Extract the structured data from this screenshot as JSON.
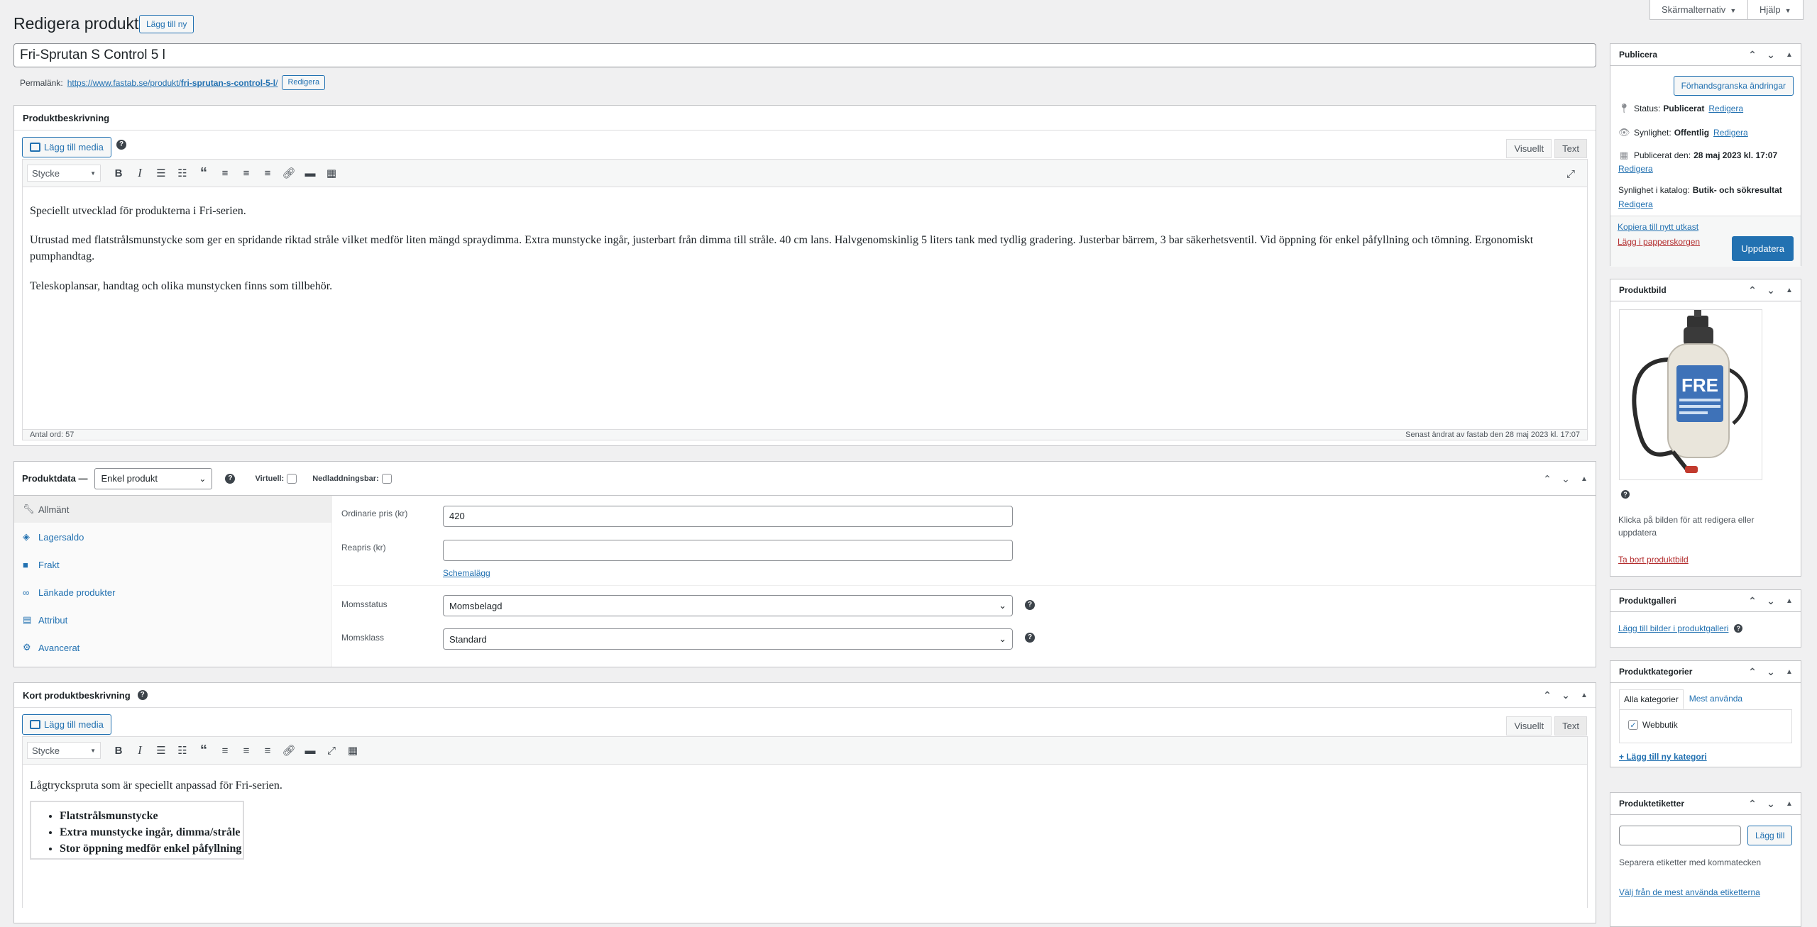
{
  "header": {
    "title": "Redigera produkt",
    "add_new": "Lägg till ny",
    "screen_options": "Skärmalternativ",
    "help": "Hjälp"
  },
  "product": {
    "title": "Fri-Sprutan S Control 5 l",
    "permalink_label": "Permalänk:",
    "permalink_base": "https://www.fastab.se/produkt/",
    "permalink_slug": "fri-sprutan-s-control-5-l",
    "permalink_end": "/",
    "permalink_edit": "Redigera"
  },
  "description_box": {
    "title": "Produktbeskrivning",
    "add_media": "Lägg till media",
    "tab_visual": "Visuellt",
    "tab_text": "Text",
    "format_select": "Stycke",
    "paragraphs": [
      "Speciellt utvecklad för produkterna i Fri-serien.",
      "Utrustad med flatstrålsmunstycke som ger en spridande riktad stråle vilket medför liten mängd spraydimma. Extra munstycke ingår, justerbart från dimma till stråle. 40 cm lans. Halvgenomskinlig 5 liters tank med tydlig gradering. Justerbar bärrem, 3 bar säkerhetsventil. Vid öppning för enkel påfyllning och tömning. Ergonomiskt pumphandtag.",
      "Teleskoplansar, handtag och olika munstycken finns som tillbehör."
    ],
    "word_count": "Antal ord: 57",
    "last_edited": "Senast ändrat av fastab den 28 maj 2023 kl. 17:07"
  },
  "product_data": {
    "title": "Produktdata —",
    "type": "Enkel produkt",
    "virtual_label": "Virtuell:",
    "downloadable_label": "Nedladdningsbar:",
    "tabs": [
      {
        "label": "Allmänt",
        "icon": "wrench-icon"
      },
      {
        "label": "Lagersaldo",
        "icon": "tag-icon"
      },
      {
        "label": "Frakt",
        "icon": "truck-icon"
      },
      {
        "label": "Länkade produkter",
        "icon": "link-icon"
      },
      {
        "label": "Attribut",
        "icon": "table-icon"
      },
      {
        "label": "Avancerat",
        "icon": "gear-icon"
      }
    ],
    "regular_price_label": "Ordinarie pris (kr)",
    "regular_price": "420",
    "sale_price_label": "Reapris (kr)",
    "sale_price": "",
    "schedule": "Schemalägg",
    "tax_status_label": "Momsstatus",
    "tax_status": "Momsbelagd",
    "tax_class_label": "Momsklass",
    "tax_class": "Standard"
  },
  "short_description_box": {
    "title": "Kort produktbeskrivning",
    "add_media": "Lägg till media",
    "tab_visual": "Visuellt",
    "tab_text": "Text",
    "format_select": "Stycke",
    "intro": "Lågtryckspruta som är speciellt anpassad för Fri-serien.",
    "bullets": [
      "Flatstrålsmunstycke",
      "Extra munstycke ingår, dimma/stråle",
      "Stor öppning medför enkel påfyllning"
    ]
  },
  "publish": {
    "title": "Publicera",
    "preview": "Förhandsgranska ändringar",
    "status_label": "Status:",
    "status_value": "Publicerat",
    "visibility_label": "Synlighet:",
    "visibility_value": "Offentlig",
    "published_label": "Publicerat den:",
    "published_value": "28 maj 2023 kl. 17:07",
    "catalog_label": "Synlighet i katalog:",
    "catalog_value": "Butik- och sökresultat",
    "edit": "Redigera",
    "copy_draft": "Kopiera till nytt utkast",
    "trash": "Lägg i papperskorgen",
    "update": "Uppdatera"
  },
  "product_image": {
    "title": "Produktbild",
    "label_text": "FRE",
    "hint": "Klicka på bilden för att redigera eller uppdatera",
    "remove": "Ta bort produktbild"
  },
  "gallery": {
    "title": "Produktgalleri",
    "add": "Lägg till bilder i produktgalleri"
  },
  "categories": {
    "title": "Produktkategorier",
    "tab_all": "Alla kategorier",
    "tab_popular": "Mest använda",
    "items": [
      {
        "label": "Webbutik",
        "checked": true
      }
    ],
    "add_new": "+ Lägg till ny kategori"
  },
  "tags": {
    "title": "Produktetiketter",
    "add_button": "Lägg till",
    "hint": "Separera etiketter med kommatecken",
    "choose": "Välj från de mest använda etiketterna"
  }
}
